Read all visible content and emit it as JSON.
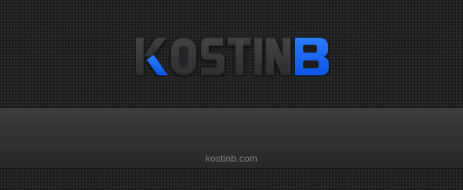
{
  "logo": {
    "letters": [
      "K",
      "O",
      "S",
      "T",
      "I",
      "N",
      "B"
    ],
    "accent_color": "#1a6dff",
    "letter_color": "#3a3a3c"
  },
  "footer": {
    "text": "kostinb.com"
  }
}
